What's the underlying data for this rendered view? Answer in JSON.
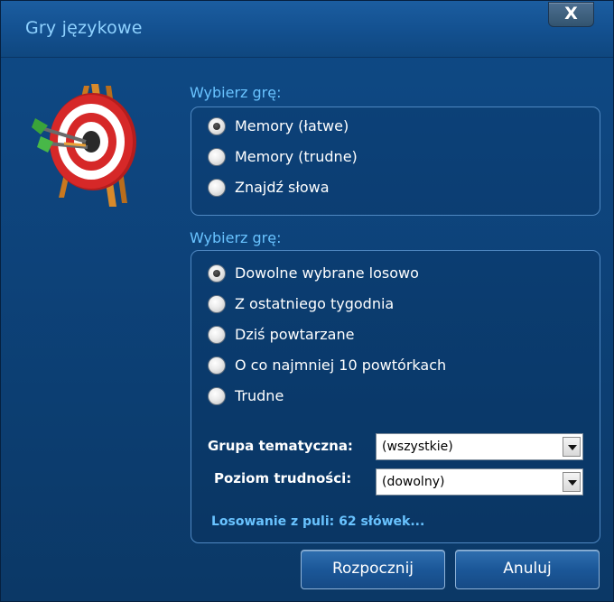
{
  "window": {
    "title": "Gry językowe",
    "close_label": "X"
  },
  "game_section": {
    "label": "Wybierz grę:",
    "options": [
      {
        "label": "Memory (łatwe)",
        "selected": true
      },
      {
        "label": "Memory (trudne)",
        "selected": false
      },
      {
        "label": "Znajdź słowa",
        "selected": false
      }
    ]
  },
  "word_section": {
    "label": "Wybierz grę:",
    "options": [
      {
        "label": "Dowolne wybrane losowo",
        "selected": true
      },
      {
        "label": "Z ostatniego tygodnia",
        "selected": false
      },
      {
        "label": "Dziś powtarzane",
        "selected": false
      },
      {
        "label": "O co najmniej 10 powtórkach",
        "selected": false
      },
      {
        "label": "Trudne",
        "selected": false
      }
    ],
    "topic_group": {
      "label": "Grupa tematyczna:",
      "value": "(wszystkie)"
    },
    "difficulty": {
      "label": "Poziom trudności:",
      "value": "(dowolny)"
    },
    "pool_info": "Losowanie z puli: 62 słówek..."
  },
  "buttons": {
    "start": "Rozpocznij",
    "cancel": "Anuluj"
  },
  "icons": {
    "target": "dartboard-target-icon",
    "close": "close-icon",
    "dropdown": "chevron-down-icon"
  }
}
